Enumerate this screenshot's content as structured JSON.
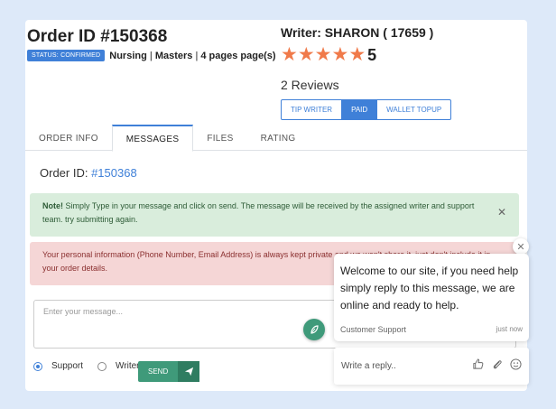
{
  "order": {
    "title": "Order ID #150368",
    "status_badge": "STATUS: CONFIRMED",
    "subject": "Nursing",
    "level": "Masters",
    "pages": "4 pages page(s)"
  },
  "writer": {
    "name": "Writer: SHARON ( 17659 )",
    "rating": "5",
    "stars": 5,
    "reviews": "2 Reviews",
    "buttons": [
      "TIP WRITER",
      "PAID",
      "WALLET TOPUP"
    ]
  },
  "tabs": [
    "ORDER INFO",
    "MESSAGES",
    "FILES",
    "RATING"
  ],
  "messages": {
    "order_id_label": "Order ID: ",
    "order_id_value": "#150368",
    "note_strong": "Note!",
    "note_text": " Simply Type in your message and click on send. The message will be received by the assigned writer and support team.",
    "note_strong2": " try submitting again.",
    "privacy_text": "Your personal information (Phone Number, Email Address) is always kept private and we won't share it, just don't include it in your order details.",
    "placeholder": "Enter your message...",
    "radio_support": "Support",
    "radio_writer": "Writer",
    "send_label": "SEND"
  },
  "chat": {
    "message": "Welcome to our site, if you need help simply reply to this message, we are online and ready to help.",
    "sender": "Customer Support",
    "time": "just now",
    "reply_placeholder": "Write a reply.."
  },
  "colors": {
    "accent": "#3f80d8",
    "star": "#f07a4a",
    "send": "#3f9a7a",
    "success_bg": "#d9eddc",
    "danger_bg": "#f5d6d6"
  }
}
